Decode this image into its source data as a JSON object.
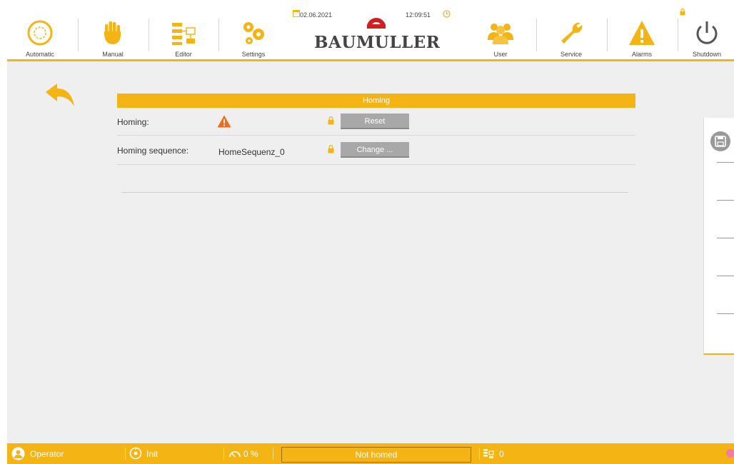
{
  "toolbar": {
    "items": [
      {
        "label": "Automatic",
        "icon": "automatic-icon"
      },
      {
        "label": "Manual",
        "icon": "hand-icon"
      },
      {
        "label": "Editor",
        "icon": "editor-icon"
      },
      {
        "label": "Settings",
        "icon": "gears-icon"
      },
      {
        "label": "User",
        "icon": "users-icon"
      },
      {
        "label": "Service",
        "icon": "wrench-icon"
      },
      {
        "label": "Alarms",
        "icon": "warning-icon"
      },
      {
        "label": "Shutdown",
        "icon": "power-icon"
      }
    ],
    "date": "02.06.2021",
    "time": "12:09:51",
    "brand": "BAUMULLER"
  },
  "panel": {
    "title": "Homing",
    "rows": [
      {
        "label": "Homing:",
        "value": "",
        "status_icon": "warning-icon",
        "button": "Reset"
      },
      {
        "label": "Homing sequence:",
        "value": "HomeSequenz_0",
        "button": "Change ..."
      }
    ]
  },
  "statusbar": {
    "user": "Operator",
    "state": "Init",
    "override": "0 %",
    "message": "Not homed",
    "program": "0"
  },
  "colors": {
    "accent": "#f4b414",
    "warning": "#f26a1b",
    "button": "#a8a8a8",
    "brand_logo": "#d11f1f",
    "alarm_indicator": "#f07aa8"
  }
}
